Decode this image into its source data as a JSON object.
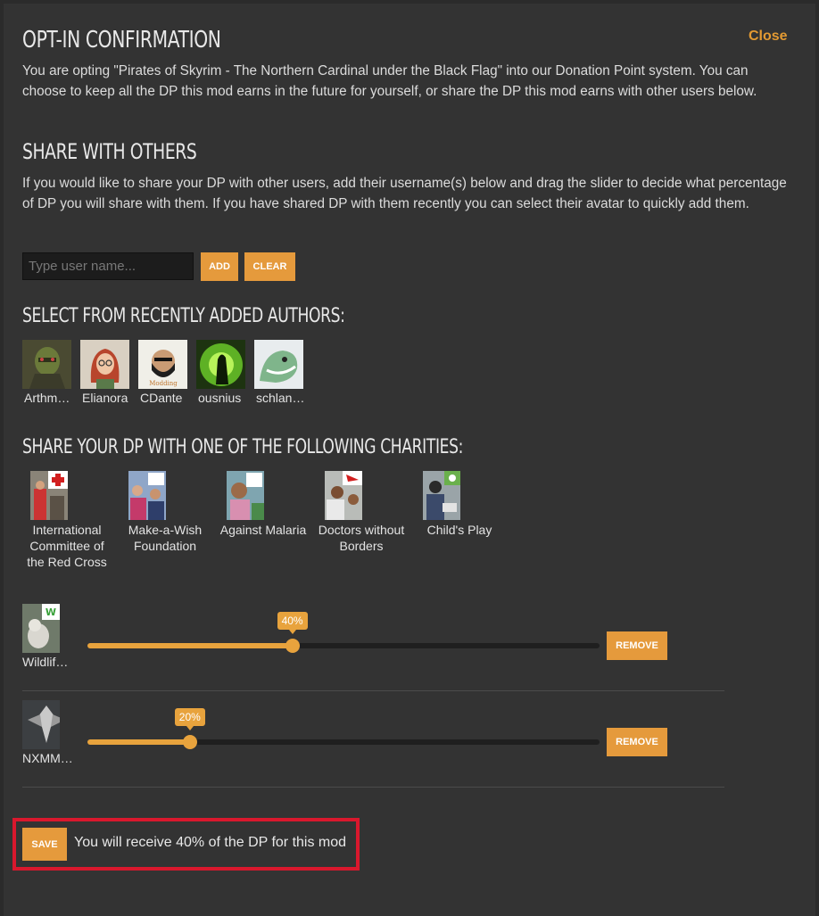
{
  "modal": {
    "close_label": "Close",
    "title": "OPT-IN CONFIRMATION",
    "intro": "You are opting \"Pirates of Skyrim - The Northern Cardinal under the Black Flag\" into our Donation Point system. You can choose to keep all the DP this mod earns in the future for yourself, or share the DP this mod earns with other users below."
  },
  "share_with_others": {
    "heading": "SHARE WITH OTHERS",
    "description": "If you would like to share your DP with other users, add their username(s) below and drag the slider to decide what percentage of DP you will share with them. If you have shared DP with them recently you can select their avatar to quickly add them.",
    "input_value": "",
    "input_placeholder": "Type user name...",
    "add_label": "ADD",
    "clear_label": "CLEAR"
  },
  "recent_authors": {
    "heading": "SELECT FROM RECENTLY ADDED AUTHORS:",
    "items": [
      {
        "name": "Arthm…",
        "icon": "green-armored-warrior-avatar"
      },
      {
        "name": "Elianora",
        "icon": "red-haired-woman-avatar"
      },
      {
        "name": "CDante",
        "icon": "bearded-man-avatar"
      },
      {
        "name": "ousnius",
        "icon": "green-silhouette-avatar"
      },
      {
        "name": "schlan…",
        "icon": "green-creature-avatar"
      }
    ]
  },
  "charities": {
    "heading": "SHARE YOUR DP WITH ONE OF THE FOLLOWING CHARITIES:",
    "items": [
      {
        "name": "International Committee of the Red Cross",
        "icon": "red-cross-photo"
      },
      {
        "name": "Make-a-Wish Foundation",
        "icon": "make-a-wish-photo"
      },
      {
        "name": "Against Malaria",
        "icon": "against-malaria-photo"
      },
      {
        "name": "Doctors without Borders",
        "icon": "doctors-without-borders-photo"
      },
      {
        "name": "Child's Play",
        "icon": "childs-play-photo"
      }
    ]
  },
  "shares": [
    {
      "name": "Wildlife…",
      "percent": 40,
      "percent_label": "40%",
      "remove_label": "REMOVE",
      "icon": "wwf-wildlife-avatar"
    },
    {
      "name": "NXMM…",
      "percent": 20,
      "percent_label": "20%",
      "remove_label": "REMOVE",
      "icon": "skyrim-dragon-emblem-avatar"
    }
  ],
  "footer": {
    "save_label": "SAVE",
    "message": "You will receive 40% of the DP for this mod"
  },
  "colors": {
    "accent": "#e59a3c",
    "background": "#333333",
    "highlight": "#d9182d"
  }
}
